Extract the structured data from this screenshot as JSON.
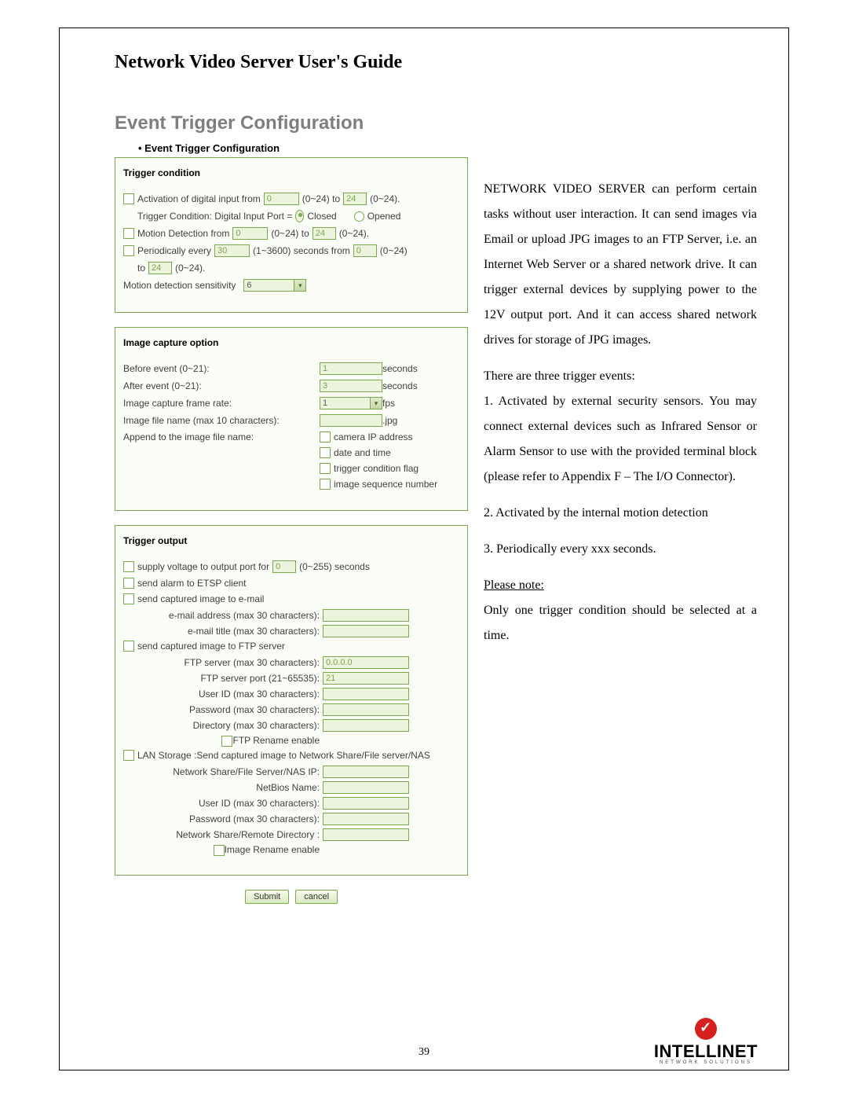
{
  "doc_title": "Network Video Server User's Guide",
  "page_title": "Event Trigger Configuration",
  "config_header": "Event Trigger Configuration",
  "page_number": "39",
  "logo": {
    "name": "INTELLINET",
    "tagline": "NETWORK   SOLUTIONS"
  },
  "trigger_condition": {
    "title": "Trigger condition",
    "act_label": "Activation of digital input from",
    "act_from": "0",
    "act_range1": "(0~24) to",
    "act_to": "24",
    "act_range2": "(0~24).",
    "tc_label": "Trigger Condition: Digital Input Port =",
    "closed": "Closed",
    "opened": "Opened",
    "md_label": "Motion Detection from",
    "md_from": "0",
    "md_r1": "(0~24) to",
    "md_to": "24",
    "md_r2": "(0~24).",
    "pe_label": "Periodically every",
    "pe_val": "30",
    "pe_r": "(1~3600) seconds from",
    "pe_from": "0",
    "pe_r2": "(0~24)",
    "to_label": "to",
    "to_val": "24",
    "to_r": "(0~24).",
    "sens_label": "Motion detection sensitivity",
    "sens_val": "6"
  },
  "image_capture": {
    "title": "Image capture option",
    "before_label": "Before event (0~21):",
    "before_val": "1",
    "seconds": "seconds",
    "after_label": "After event (0~21):",
    "after_val": "3",
    "rate_label": "Image capture frame rate:",
    "rate_val": "1",
    "fps": "fps",
    "fname_label": "Image file name (max 10 characters):",
    "jpg": ".jpg",
    "append_label": "Append to the image file name:",
    "a1": "camera IP address",
    "a2": "date and time",
    "a3": "trigger condition flag",
    "a4": "image sequence number"
  },
  "trigger_output": {
    "title": "Trigger output",
    "supply_label": "supply voltage to output port for",
    "supply_val": "0",
    "supply_r": "(0~255) seconds",
    "etsp": "send alarm to ETSP client",
    "email": "send captured image to e-mail",
    "email_addr": "e-mail address (max 30 characters):",
    "email_title": "e-mail title (max 30 characters):",
    "ftp": "send captured image to FTP server",
    "ftp_server": "FTP server (max 30 characters):",
    "ftp_server_val": "0.0.0.0",
    "ftp_port": "FTP server port (21~65535):",
    "ftp_port_val": "21",
    "ftp_user": "User ID (max 30 characters):",
    "ftp_pass": "Password (max 30 characters):",
    "ftp_dir": "Directory (max 30 characters):",
    "ftp_rename": "FTP Rename enable",
    "lan": "LAN Storage :Send captured image to Network Share/File server/NAS",
    "lan_ip": "Network Share/File Server/NAS IP:",
    "lan_nb": "NetBios Name:",
    "lan_user": "User ID (max 30 characters):",
    "lan_pass": "Password (max 30 characters):",
    "lan_dir": "Network Share/Remote Directory :",
    "lan_rename": "Image Rename enable"
  },
  "buttons": {
    "submit": "Submit",
    "cancel": "cancel"
  },
  "body_text": {
    "p1": "NETWORK VIDEO SERVER can perform certain tasks without user interaction. It can send images via Email or upload JPG images to an FTP Server, i.e. an Internet Web Server or a shared network drive. It can trigger external devices by supplying power to the 12V output port. And it can access shared network drives for storage of JPG images.",
    "p2": "There are three trigger events:",
    "p3": "1. Activated by external security sensors. You may connect external devices such as Infrared Sensor or Alarm Sensor to use with the provided terminal block (please refer to Appendix F – The I/O Connector).",
    "p4": "2. Activated by the internal motion detection",
    "p5": "3. Periodically every xxx seconds.",
    "p6": "Please note:",
    "p7": "Only one trigger condition should be selected at a time."
  }
}
